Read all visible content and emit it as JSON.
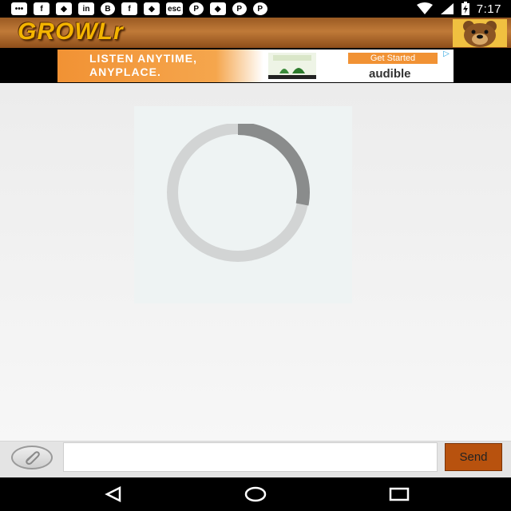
{
  "status_bar": {
    "time": "7:17",
    "notification_icons": [
      {
        "name": "message-icon",
        "glyph": "•••"
      },
      {
        "name": "facebook-icon",
        "glyph": "f"
      },
      {
        "name": "app-icon",
        "glyph": "◆"
      },
      {
        "name": "linkedin-icon",
        "glyph": "in"
      },
      {
        "name": "bbm-icon",
        "glyph": "B"
      },
      {
        "name": "facebook-icon",
        "glyph": "f"
      },
      {
        "name": "app-icon",
        "glyph": "◆"
      },
      {
        "name": "esc-icon",
        "glyph": "esc"
      },
      {
        "name": "pinterest-icon",
        "glyph": "P"
      },
      {
        "name": "app-icon",
        "glyph": "◆"
      },
      {
        "name": "pinterest-icon",
        "glyph": "P"
      },
      {
        "name": "pinterest-icon",
        "glyph": "P"
      }
    ]
  },
  "app": {
    "logo_text": "GROWLr"
  },
  "ad": {
    "headline_line1": "LISTEN ANYTIME,",
    "headline_line2": "ANYPLACE.",
    "cta": "Get Started",
    "brand": "audible",
    "accent_color": "#f19234"
  },
  "compose": {
    "message_value": "",
    "message_placeholder": "",
    "send_label": "Send",
    "send_color": "#b8520e"
  },
  "loading": {
    "spinner_progress_fraction": 0.28
  }
}
